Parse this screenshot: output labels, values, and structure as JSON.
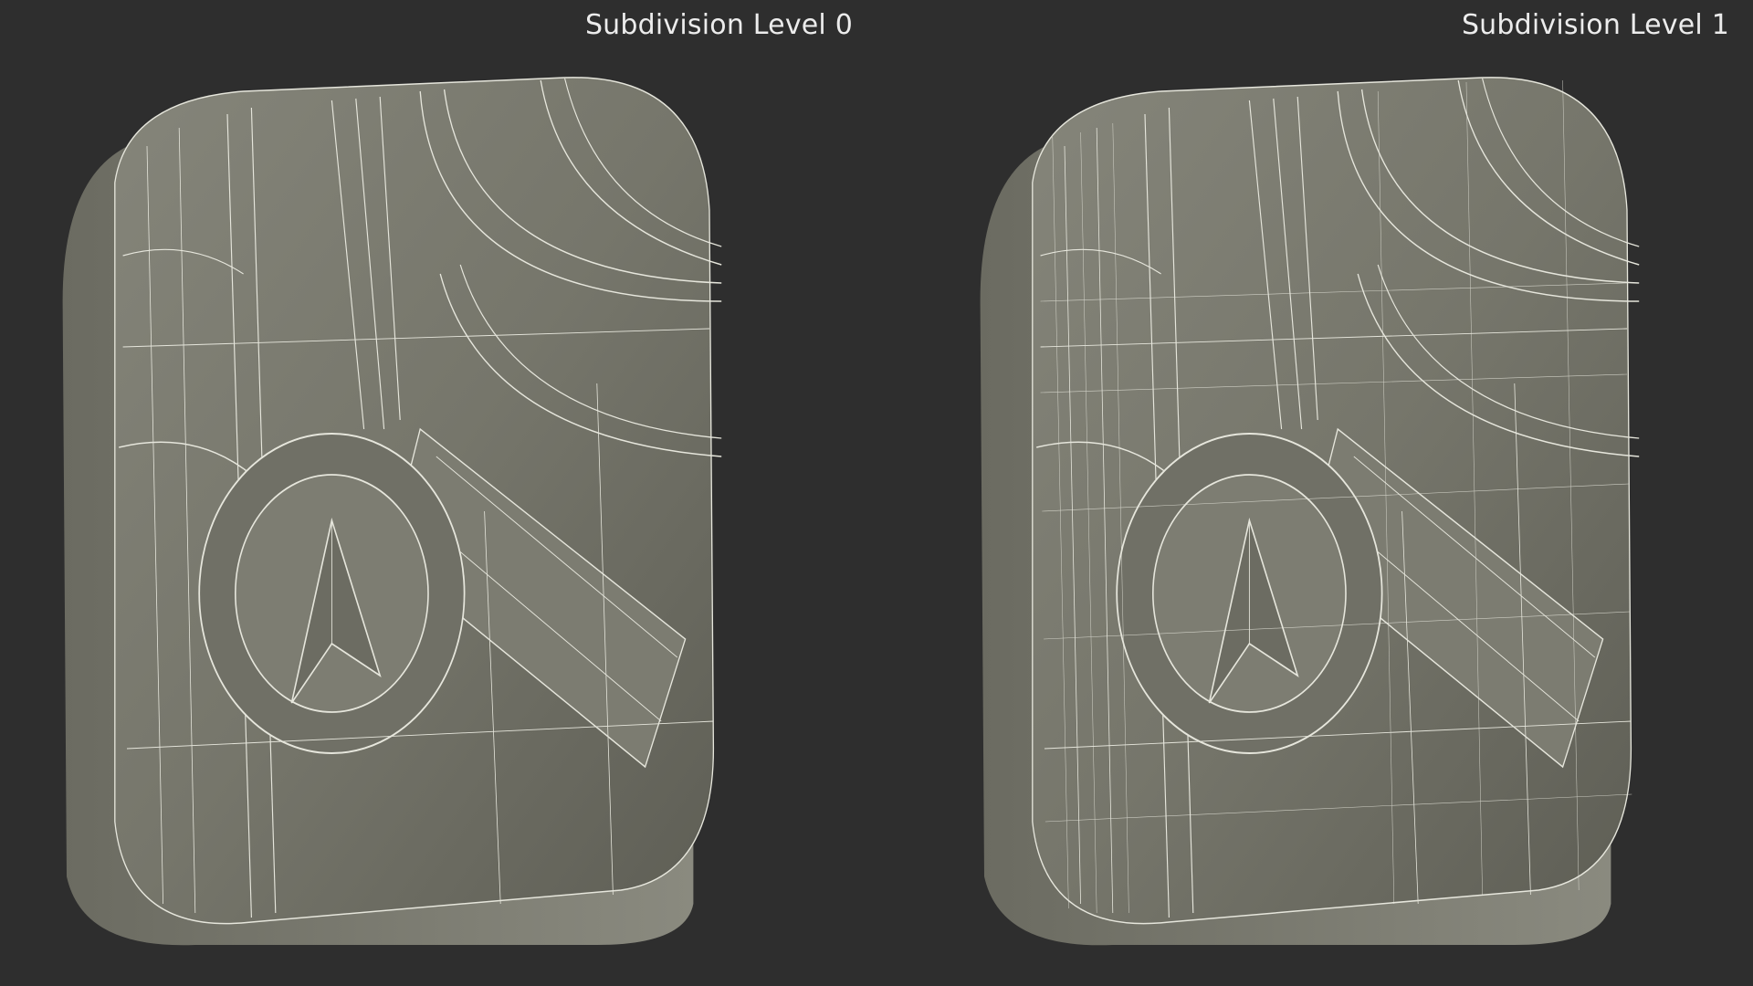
{
  "labels": {
    "left": "Subdivision Level 0",
    "right": "Subdivision Level 1"
  },
  "colors": {
    "background": "#2e2e2e",
    "surface": "#7a7a6e",
    "surface_dark": "#5f5f55",
    "wire": "#e6e6dc",
    "label": "#ececec"
  },
  "icon": "map-app-icon-3d-model"
}
